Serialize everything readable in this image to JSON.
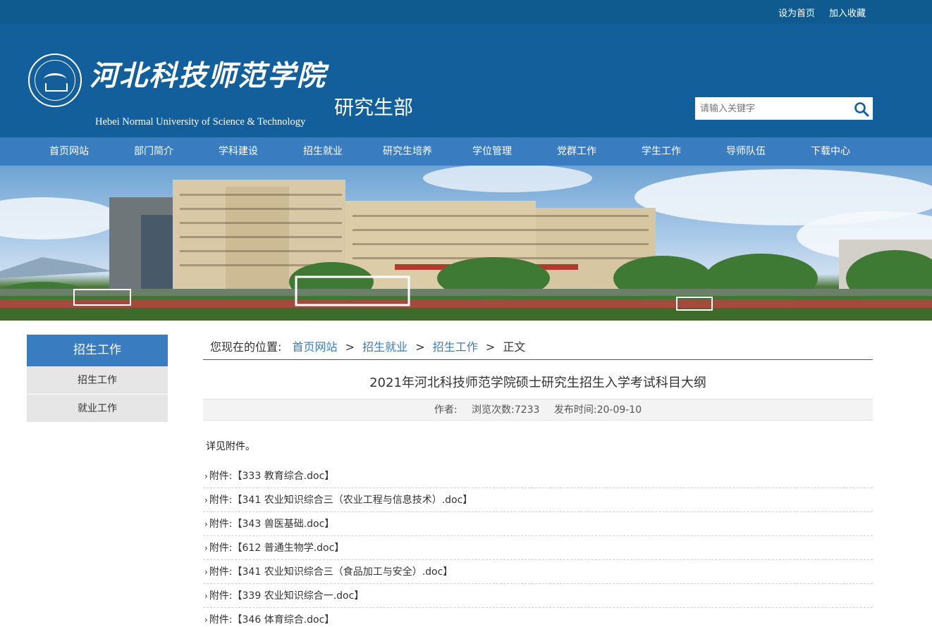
{
  "topbar": {
    "set_home": "设为首页",
    "bookmark": "加入收藏"
  },
  "header": {
    "logo_cn": "河北科技师范学院",
    "logo_en": "Hebei Normal University of Science & Technology",
    "dept": "研究生部",
    "search_placeholder": "请输入关键字"
  },
  "nav": [
    "首页网站",
    "部门简介",
    "学科建设",
    "招生就业",
    "研究生培养",
    "学位管理",
    "党群工作",
    "学生工作",
    "导师队伍",
    "下载中心"
  ],
  "sidebar": {
    "title": "招生工作",
    "items": [
      "招生工作",
      "就业工作"
    ]
  },
  "breadcrumb": {
    "label": "您现在的位置:",
    "links": [
      "首页网站",
      "招生就业",
      "招生工作"
    ],
    "current": "正文",
    "separator": ">"
  },
  "article": {
    "title": "2021年河北科技师范学院硕士研究生招生入学考试科目大纲",
    "author_label": "作者:",
    "views_label": "浏览次数:",
    "views": "7233",
    "date_label": "发布时间:",
    "date": "20-09-10",
    "body": "详见附件。",
    "attachments": [
      "附件:【333 教育综合.doc】",
      "附件:【341 农业知识综合三（农业工程与信息技术）.doc】",
      "附件:【343 兽医基础.doc】",
      "附件:【612 普通生物学.doc】",
      "附件:【341 农业知识综合三（食品加工与安全）.doc】",
      "附件:【339 农业知识综合一.doc】",
      "附件:【346 体育综合.doc】"
    ]
  },
  "colors": {
    "topbar": "#0f5a8f",
    "header": "#135f9c",
    "nav": "#3a7cc0",
    "link": "#3a7cc0"
  }
}
